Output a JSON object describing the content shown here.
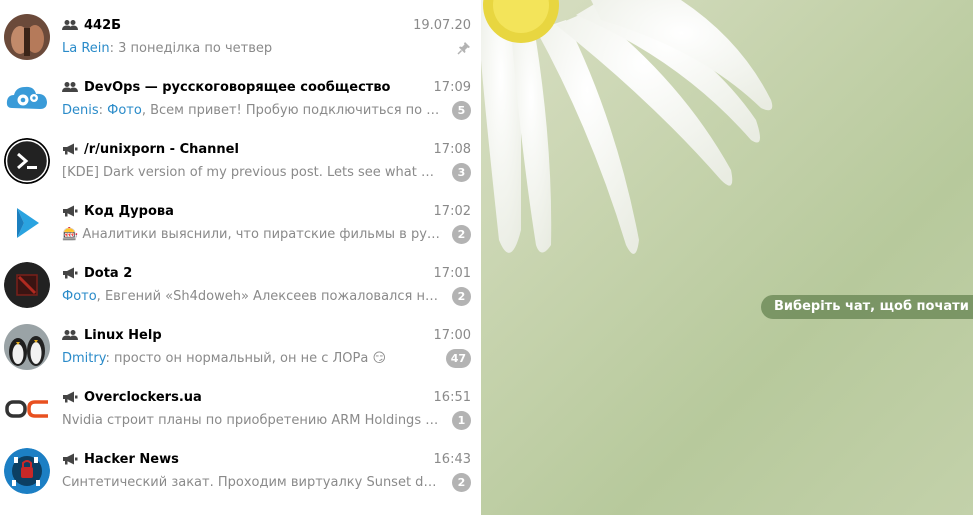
{
  "chats": [
    {
      "name": "442Б",
      "type": "group",
      "time": "19.07.20",
      "sender": "La Rein",
      "media": "",
      "text": "3 понеділка по четвер",
      "badge": "",
      "pinned": true,
      "avatar": "photo-brown"
    },
    {
      "name": "DevOps — русскоговорящее сообщество",
      "type": "group",
      "time": "17:09",
      "sender": "Denis",
      "media": "Фото",
      "text": "Всем привет! Пробую подключиться по …",
      "badge": "5",
      "pinned": false,
      "avatar": "gears-cloud"
    },
    {
      "name": "/r/unixporn - Channel",
      "type": "channel",
      "time": "17:08",
      "sender": "",
      "media": "",
      "text": "[KDE] Dark version of my previous post. Lets see what g…",
      "badge": "3",
      "pinned": false,
      "avatar": "terminal"
    },
    {
      "name": "Код Дурова",
      "type": "channel",
      "time": "17:02",
      "sender": "",
      "media": "",
      "text": "🎰 Аналитики выяснили, что пиратские фильмы в ру…",
      "badge": "2",
      "pinned": false,
      "avatar": "durov-code"
    },
    {
      "name": "Dota 2",
      "type": "channel",
      "time": "17:01",
      "sender": "",
      "media": "Фото",
      "text": "Евгений «Sh4doweh» Алексеев пожаловался на…",
      "badge": "2",
      "pinned": false,
      "avatar": "dota"
    },
    {
      "name": "Linux Help",
      "type": "group",
      "time": "17:00",
      "sender": "Dmitry",
      "media": "",
      "text": "просто он нормальный, он не с ЛОРа 😏",
      "badge": "47",
      "pinned": false,
      "avatar": "penguins"
    },
    {
      "name": "Overclockers.ua",
      "type": "channel",
      "time": "16:51",
      "sender": "",
      "media": "",
      "text": "Nvidia строит планы по приобретению ARM Holdings …",
      "badge": "1",
      "pinned": false,
      "avatar": "oc-logo"
    },
    {
      "name": "Hacker News",
      "type": "channel",
      "time": "16:43",
      "sender": "",
      "media": "",
      "text": "Синтетический закат. Проходим виртуалку Sunset de…",
      "badge": "2",
      "pinned": false,
      "avatar": "hacker"
    }
  ],
  "empty_state": {
    "hint": "Виберіть чат, щоб почати"
  },
  "colors": {
    "accent": "#2a8bc9",
    "badge": "#b3b3b3",
    "muted": "#8a8a8a"
  }
}
